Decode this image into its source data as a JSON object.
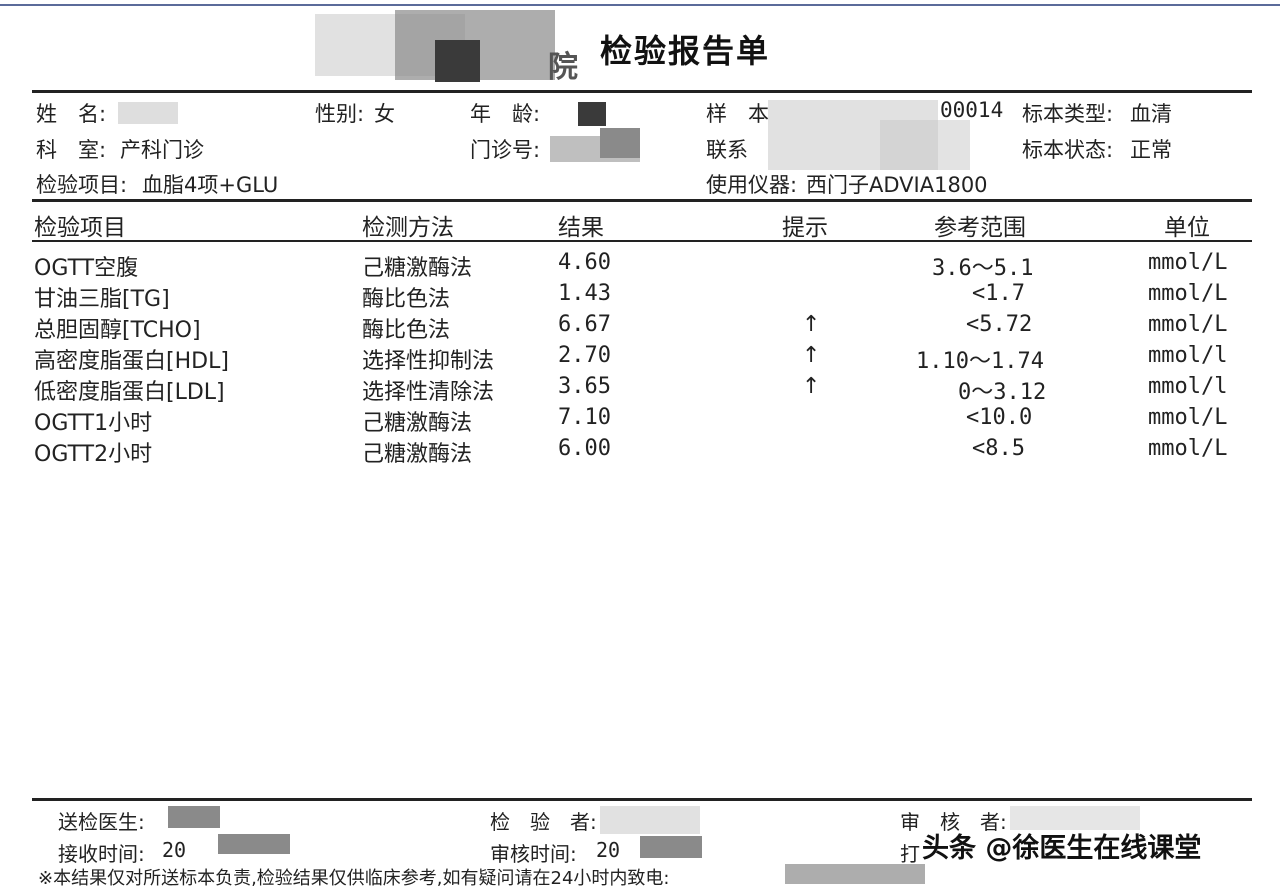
{
  "report": {
    "hospital_visible": "院",
    "title": "检验报告单"
  },
  "info": {
    "name_label": "姓　名:",
    "gender_label": "性别:",
    "gender_value": "女",
    "age_label": "年　龄:",
    "sample_label": "样　本",
    "sample_value": "00014",
    "specimen_type_label": "标本类型:",
    "specimen_type_value": "血清",
    "dept_label": "科　室:",
    "dept_value": "产科门诊",
    "outpatient_label": "门诊号:",
    "contact_label": "联系",
    "specimen_state_label": "标本状态:",
    "specimen_state_value": "正常",
    "test_item_label": "检验项目:",
    "test_item_value": "血脂4项+GLU",
    "instrument_label": "使用仪器:",
    "instrument_value": "西门子ADVIA1800"
  },
  "table": {
    "headers": [
      "检验项目",
      "检测方法",
      "结果",
      "提示",
      "参考范围",
      "单位"
    ],
    "rows": [
      {
        "item": "OGTT空腹",
        "method": "己糖激酶法",
        "result": "4.60",
        "flag": "",
        "range": "3.6～5.1",
        "unit": "mmol/L"
      },
      {
        "item": "甘油三脂[TG]",
        "method": "酶比色法",
        "result": "1.43",
        "flag": "",
        "range": "<1.7",
        "unit": "mmol/L"
      },
      {
        "item": "总胆固醇[TCHO]",
        "method": "酶比色法",
        "result": "6.67",
        "flag": "↑",
        "range": "<5.72",
        "unit": "mmol/L"
      },
      {
        "item": "高密度脂蛋白[HDL]",
        "method": "选择性抑制法",
        "result": "2.70",
        "flag": "↑",
        "range": "1.10～1.74",
        "unit": "mmol/l"
      },
      {
        "item": "低密度脂蛋白[LDL]",
        "method": "选择性清除法",
        "result": "3.65",
        "flag": "↑",
        "range": "0～3.12",
        "unit": "mmol/l"
      },
      {
        "item": "OGTT1小时",
        "method": "己糖激酶法",
        "result": "7.10",
        "flag": "",
        "range": "<10.0",
        "unit": "mmol/L"
      },
      {
        "item": "OGTT2小时",
        "method": "己糖激酶法",
        "result": "6.00",
        "flag": "",
        "range": "<8.5",
        "unit": "mmol/L"
      }
    ]
  },
  "footer": {
    "doctor_label": "送检医生:",
    "tester_label": "检　验　者:",
    "reviewer_label": "审　核　者:",
    "receive_time_label": "接收时间:",
    "receive_time_value": "20",
    "review_time_label": "审核时间:",
    "review_time_value": "20",
    "print_label": "打",
    "note": "※本结果仅对所送标本负责,检验结果仅供临床参考,如有疑问请在24小时内致电:"
  },
  "watermark": "头条 @徐医生在线课堂"
}
